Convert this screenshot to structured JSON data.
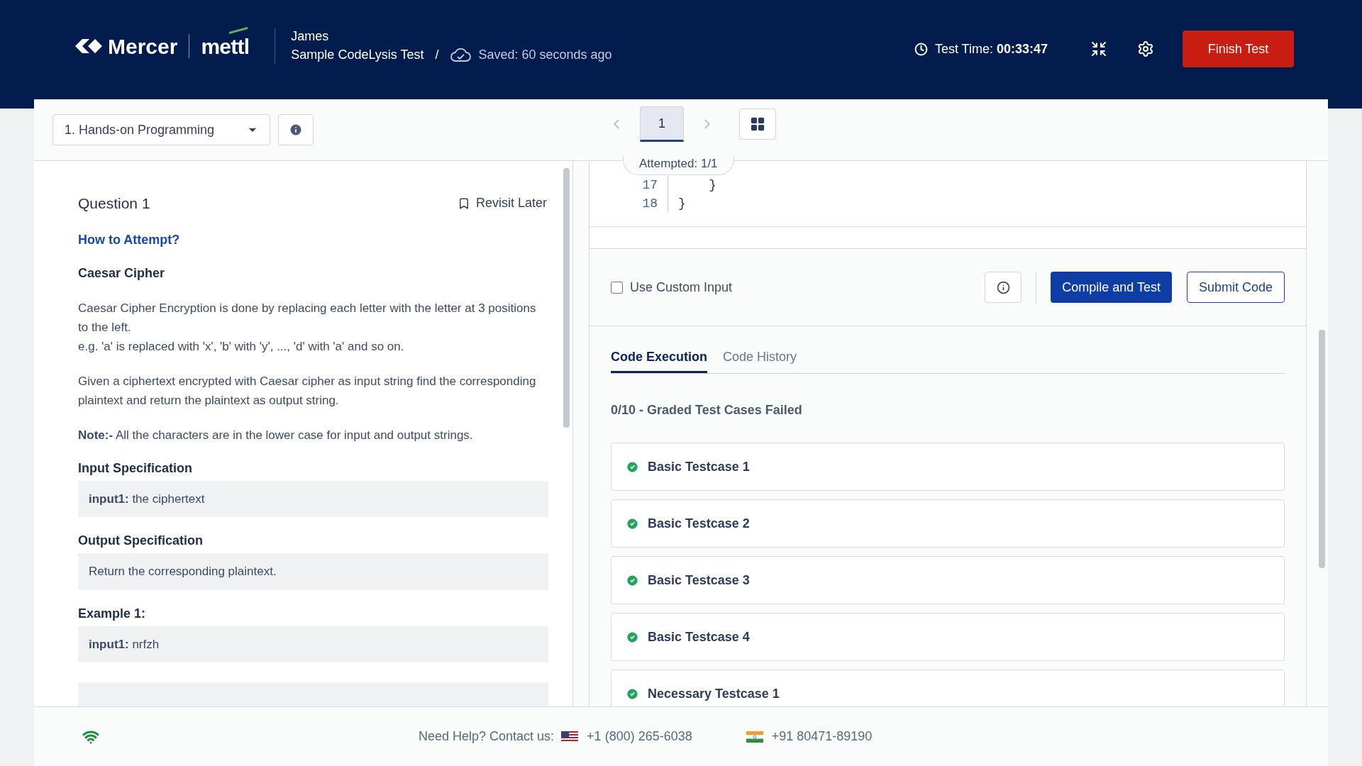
{
  "header": {
    "brand": "Mercer",
    "product": "mettl",
    "candidate": "James",
    "test_name": "Sample CodeLysis Test",
    "separator": "/",
    "saved": "Saved: 60 seconds ago",
    "timer_label": "Test Time:",
    "timer_value": "00:33:47",
    "finish_button": "Finish Test"
  },
  "toolbar": {
    "section": "1. Hands-on Programming",
    "pages": [
      {
        "label": "1",
        "selected": true
      }
    ],
    "attempted": "Attempted: 1/1"
  },
  "question": {
    "title": "Question 1",
    "revisit": "Revisit Later",
    "how_to": "How to Attempt?",
    "name": "Caesar Cipher",
    "paragraphs": [
      [
        "Caesar Cipher Encryption is done by replacing each letter with the letter at 3 positions to the left.",
        "e.g. 'a' is replaced with 'x', 'b' with 'y', ..., 'd' with 'a' and so on."
      ],
      [
        "Given a ciphertext encrypted with Caesar cipher as input string find the corresponding plaintext and return the plaintext as output string."
      ],
      [
        "**Note:-**  All the characters are in the lower case for input and output strings."
      ]
    ],
    "sections": [
      {
        "heading": "Input Specification",
        "body": "**input1:** the ciphertext"
      },
      {
        "heading": "Output Specification",
        "body": "Return the corresponding plaintext."
      },
      {
        "heading": "Example 1:",
        "body": "**input1:** nrfzh"
      }
    ]
  },
  "editor": {
    "lines": [
      {
        "number": "17",
        "code": "    }"
      },
      {
        "number": "18",
        "code": "}"
      }
    ]
  },
  "controls": {
    "custom_input": {
      "label": "Use Custom Input",
      "checked": false
    },
    "compile_button": "Compile and Test",
    "submit_button": "Submit Code"
  },
  "results": {
    "tabs": [
      {
        "label": "Code Execution",
        "selected": true
      },
      {
        "label": "Code History",
        "selected": false
      }
    ],
    "summary": "0/10 - Graded Test Cases Failed",
    "cases": [
      {
        "name": "Basic Testcase 1",
        "passed": true
      },
      {
        "name": "Basic Testcase 2",
        "passed": true
      },
      {
        "name": "Basic Testcase 3",
        "passed": true
      },
      {
        "name": "Basic Testcase 4",
        "passed": true
      },
      {
        "name": "Necessary Testcase 1",
        "passed": true
      }
    ]
  },
  "footer": {
    "help": "Need Help? Contact us:",
    "phones": [
      {
        "number": "+1 (800) 265-6038",
        "kind": "us"
      },
      {
        "number": "+91 80471-89190",
        "kind": "in"
      }
    ]
  }
}
